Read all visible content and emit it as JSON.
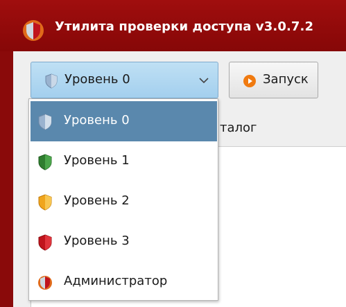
{
  "window": {
    "title": "Утилита проверки доступа v3.0.7.2"
  },
  "toolbar": {
    "level_select": {
      "selected": "Уровень 0",
      "icon": "shield-icon"
    },
    "run_button": {
      "label": "Запуск",
      "icon": "play-icon"
    }
  },
  "table": {
    "column_header_partial": "талог"
  },
  "dropdown": {
    "items": [
      {
        "label": "Уровень 0",
        "icon": "shield-gray-icon",
        "selected": true
      },
      {
        "label": "Уровень 1",
        "icon": "shield-green-icon",
        "selected": false
      },
      {
        "label": "Уровень 2",
        "icon": "shield-orange-icon",
        "selected": false
      },
      {
        "label": "Уровень 3",
        "icon": "shield-red-icon",
        "selected": false
      },
      {
        "label": "Администратор",
        "icon": "shield-admin-icon",
        "selected": false
      }
    ]
  },
  "colors": {
    "window_frame": "#8a0a0a",
    "selected_item": "#5a88ad",
    "combo_fill": "#a3cfee",
    "level_0": "#9ab3cf",
    "level_1": "#2f7d2f",
    "level_2": "#f0a51c",
    "level_3": "#c0141c",
    "run_icon": "#f07a10"
  }
}
